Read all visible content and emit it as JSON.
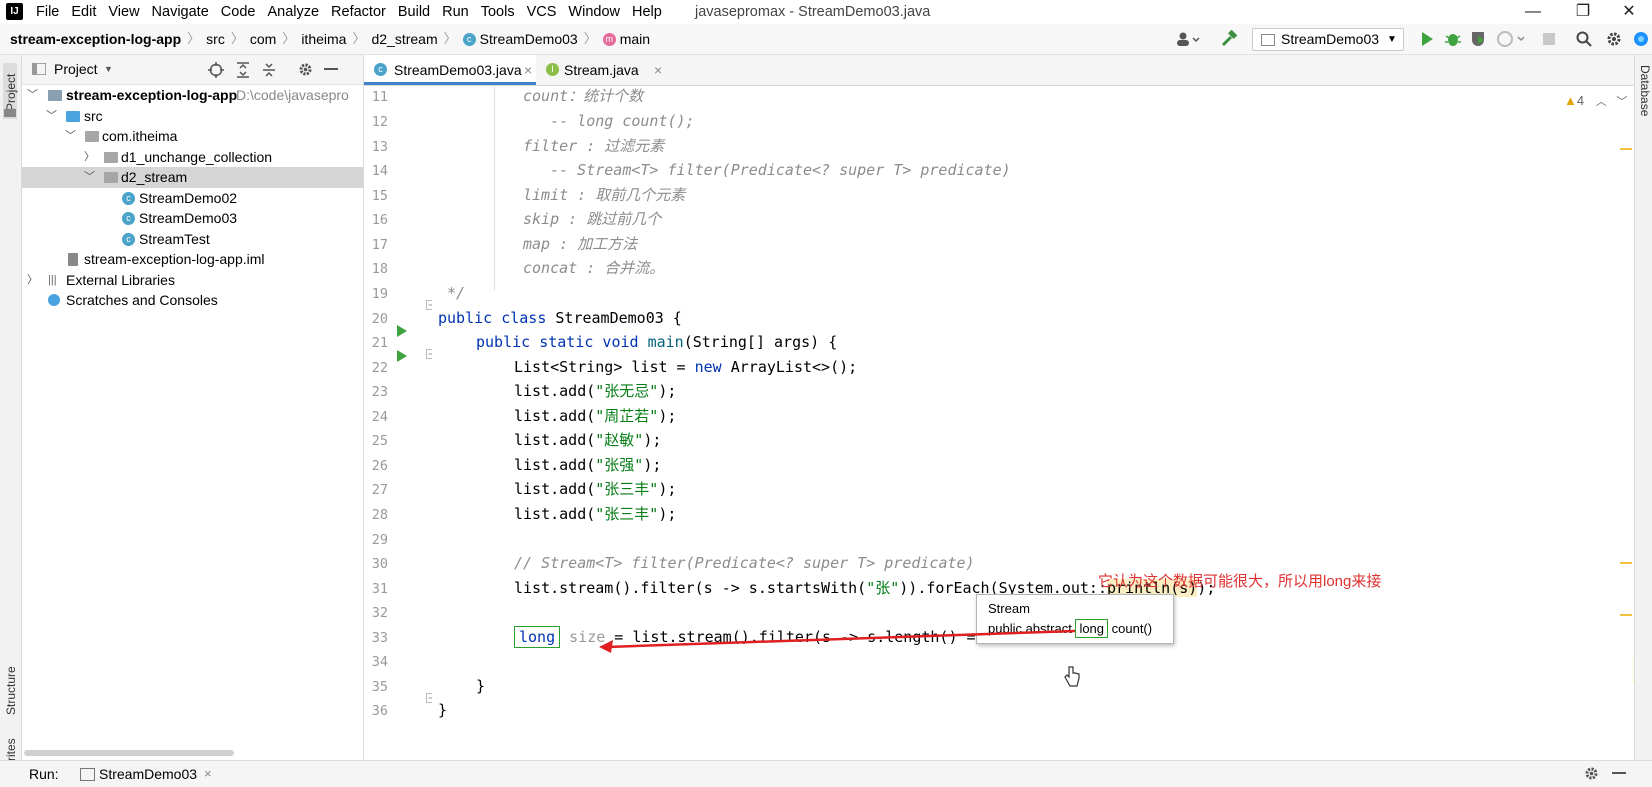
{
  "menubar": {
    "logo": "IJ",
    "items": [
      "File",
      "Edit",
      "View",
      "Navigate",
      "Code",
      "Analyze",
      "Refactor",
      "Build",
      "Run",
      "Tools",
      "VCS",
      "Window",
      "Help"
    ],
    "window_title": "javasepromax - StreamDemo03.java",
    "minimize": "—",
    "restore": "❐",
    "close": "✕"
  },
  "navbar": {
    "crumbs": [
      "stream-exception-log-app",
      "src",
      "com",
      "itheima",
      "d2_stream",
      "StreamDemo03",
      "main"
    ],
    "run_config": "StreamDemo03"
  },
  "leftstripe": {
    "project_label": "Project",
    "structure_label": "Structure",
    "favorites_label": "rites"
  },
  "project": {
    "title": "Project",
    "tree": [
      {
        "label": "stream-exception-log-app",
        "hint": "D:\\code\\javasepro",
        "icon": "module"
      },
      {
        "label": "src",
        "icon": "src"
      },
      {
        "label": "com.itheima",
        "icon": "package"
      },
      {
        "label": "d1_unchange_collection",
        "icon": "package"
      },
      {
        "label": "d2_stream",
        "icon": "package"
      },
      {
        "label": "StreamDemo02",
        "icon": "class"
      },
      {
        "label": "StreamDemo03",
        "icon": "class"
      },
      {
        "label": "StreamTest",
        "icon": "class"
      },
      {
        "label": "stream-exception-log-app.iml",
        "icon": "iml"
      },
      {
        "label": "External Libraries",
        "icon": "lib"
      },
      {
        "label": "Scratches and Consoles",
        "icon": "scratch"
      }
    ]
  },
  "tabs": [
    {
      "label": "StreamDemo03.java",
      "close": "×"
    },
    {
      "label": "Stream.java",
      "close": "×"
    }
  ],
  "editor": {
    "warnings": "4",
    "line_numbers": [
      "11",
      "12",
      "13",
      "14",
      "15",
      "16",
      "17",
      "18",
      "19",
      "20",
      "21",
      "22",
      "23",
      "24",
      "25",
      "26",
      "27",
      "28",
      "29",
      "30",
      "31",
      "32",
      "33",
      "34",
      "35",
      "36"
    ]
  },
  "popup": {
    "title": "Stream",
    "sig_pre": "public abstract ",
    "sig_long": "long",
    "sig_post": " count()"
  },
  "annotation": "它认为这个数据可能很大，所以用long来接",
  "bottom": {
    "run_label": "Run:",
    "run_tab": "StreamDemo03",
    "close": "×"
  },
  "rightstripe": {
    "database_label": "Database"
  }
}
